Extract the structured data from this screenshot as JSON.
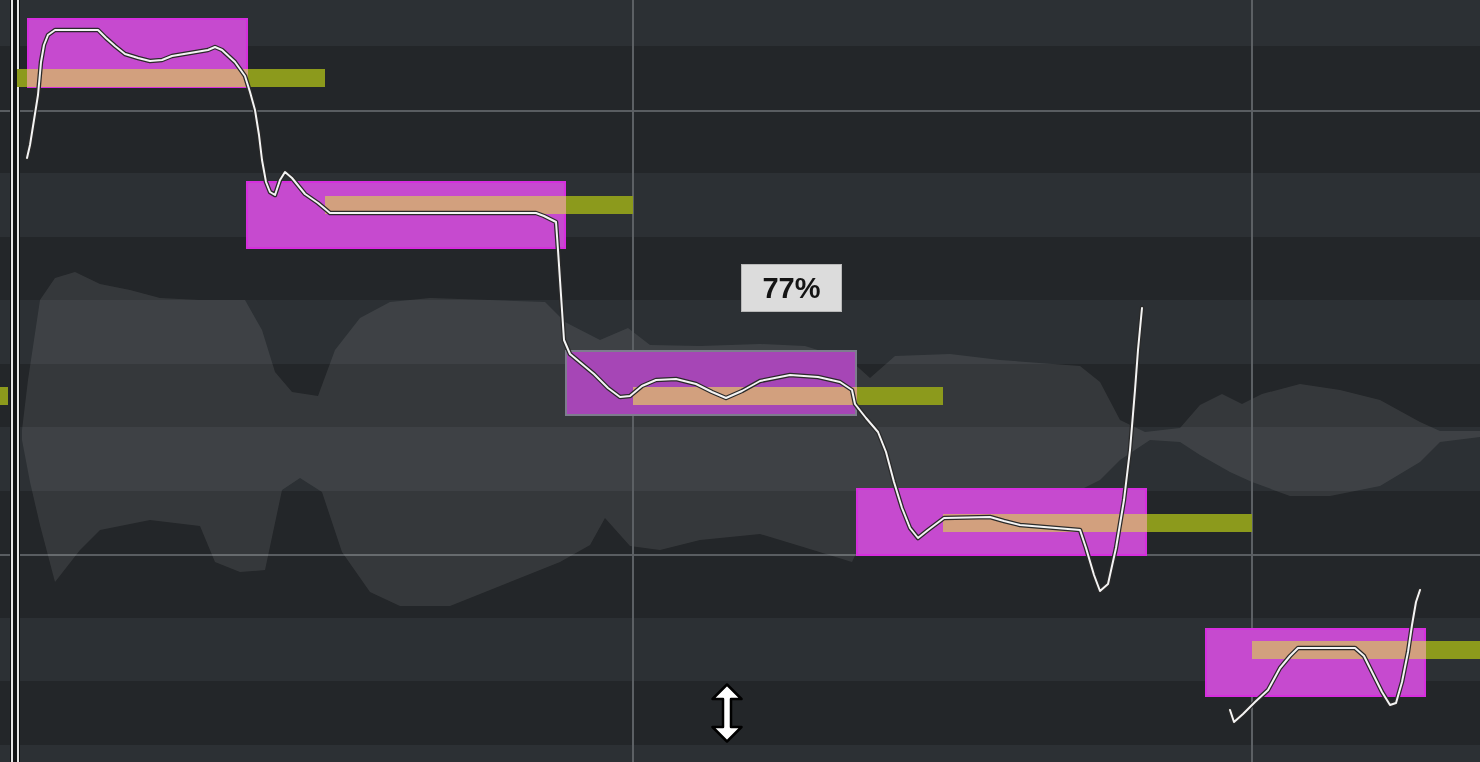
{
  "pitch_editor": {
    "notes": [
      {
        "selected": false
      },
      {
        "selected": false
      },
      {
        "selected": true
      },
      {
        "selected": false
      },
      {
        "selected": false
      }
    ],
    "tooltip": {
      "text": "77%"
    }
  }
}
